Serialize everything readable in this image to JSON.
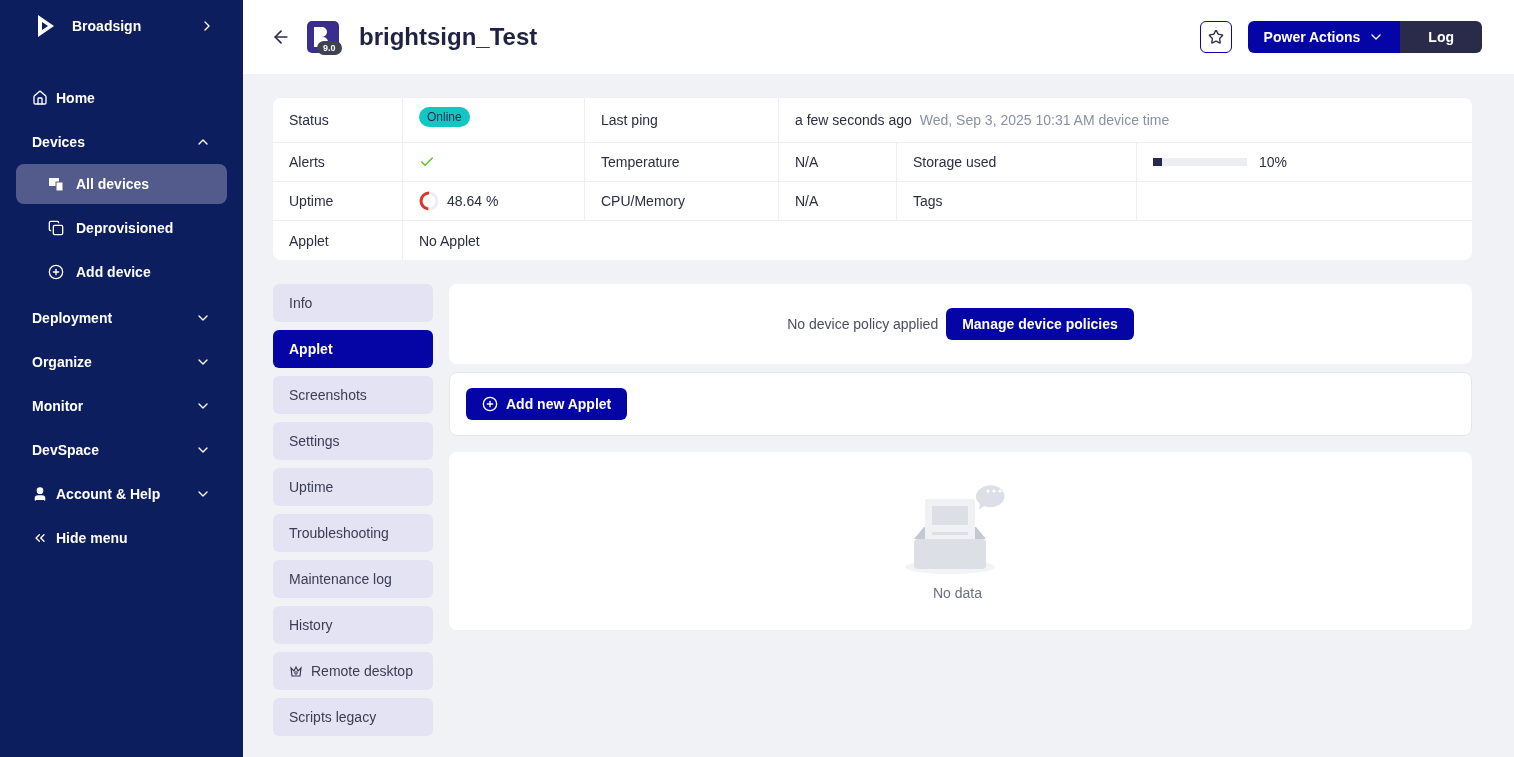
{
  "sidebar": {
    "brand": "Broadsign",
    "items": [
      {
        "kind": "link",
        "label": "Home"
      },
      {
        "kind": "group",
        "label": "Devices",
        "expanded": true,
        "children": [
          {
            "label": "All devices",
            "selected": true
          },
          {
            "label": "Deprovisioned",
            "selected": false
          },
          {
            "label": "Add device",
            "selected": false
          }
        ]
      },
      {
        "kind": "group",
        "label": "Deployment",
        "expanded": false
      },
      {
        "kind": "group",
        "label": "Organize",
        "expanded": false
      },
      {
        "kind": "group",
        "label": "Monitor",
        "expanded": false
      },
      {
        "kind": "group",
        "label": "DevSpace",
        "expanded": false
      },
      {
        "kind": "account",
        "label": "Account & Help",
        "expanded": false
      },
      {
        "kind": "collapse",
        "label": "Hide menu"
      }
    ]
  },
  "header": {
    "title": "brightsign_Test",
    "badge": "9.0",
    "buttons": [
      "Power Actions",
      "Log"
    ]
  },
  "info": {
    "status": {
      "label": "Status",
      "value": "Online"
    },
    "last_ping": {
      "label": "Last ping",
      "value": "a few seconds ago",
      "detail": "Wed, Sep 3, 2025 10:31 AM device time"
    },
    "alerts": {
      "label": "Alerts",
      "ok": true
    },
    "temperature": {
      "label": "Temperature",
      "value": "N/A"
    },
    "storage": {
      "label": "Storage used",
      "level": 0.1,
      "reading": "10%"
    },
    "uptime": {
      "label": "Uptime",
      "level": 0.4864,
      "reading": "48.64 %"
    },
    "cpu": {
      "label": "CPU/Memory",
      "value": "N/A"
    },
    "tags": {
      "label": "Tags"
    },
    "applet": {
      "label": "Applet",
      "value": "No Applet"
    }
  },
  "tabs": [
    {
      "label": "Info",
      "selected": false,
      "kind": "plain"
    },
    {
      "label": "Applet",
      "selected": true,
      "kind": "plain"
    },
    {
      "label": "Screenshots",
      "selected": false,
      "kind": "plain"
    },
    {
      "label": "Settings",
      "selected": false,
      "kind": "plain"
    },
    {
      "label": "Uptime",
      "selected": false,
      "kind": "plain"
    },
    {
      "label": "Troubleshooting",
      "selected": false,
      "kind": "plain"
    },
    {
      "label": "Maintenance log",
      "selected": false,
      "kind": "plain"
    },
    {
      "label": "History",
      "selected": false,
      "kind": "plain"
    },
    {
      "label": "Remote desktop",
      "selected": false,
      "kind": "premium"
    },
    {
      "label": "Scripts legacy",
      "selected": false,
      "kind": "plain"
    }
  ],
  "policy": {
    "text": "No device policy applied",
    "button": "Manage device policies"
  },
  "add_button": "Add new Applet",
  "empty": {
    "text": "No data"
  }
}
